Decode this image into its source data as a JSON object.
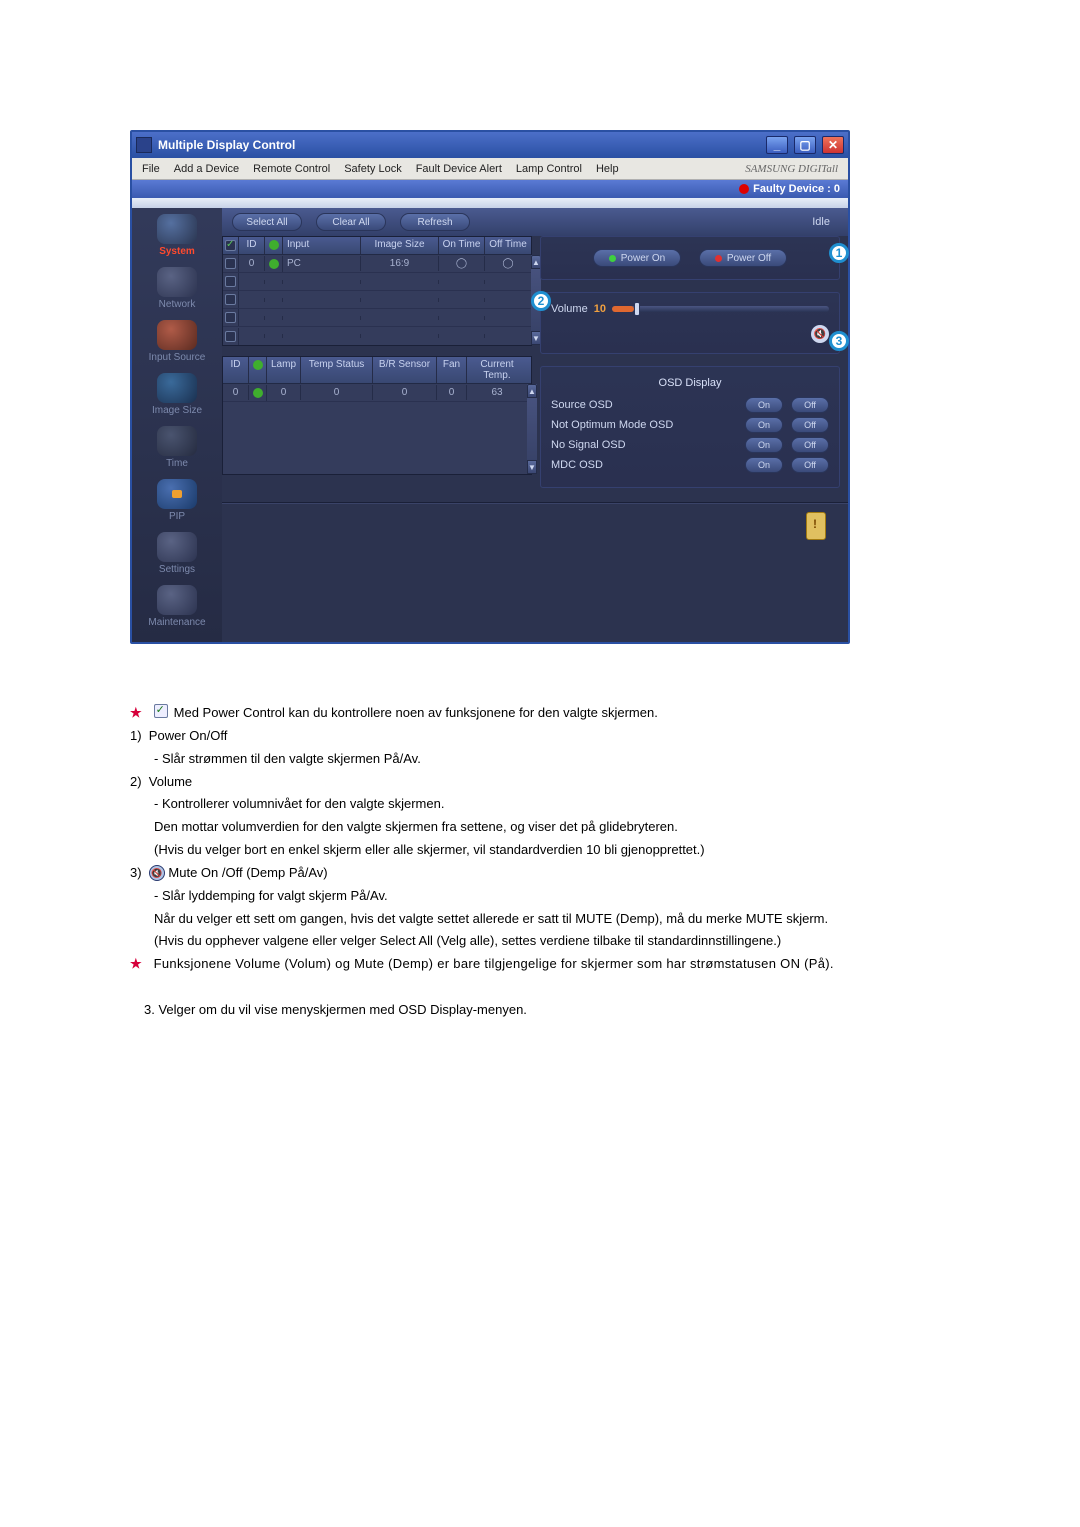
{
  "titlebar": {
    "title": "Multiple Display Control"
  },
  "menubar": {
    "items": [
      "File",
      "Add a Device",
      "Remote Control",
      "Safety Lock",
      "Fault Device Alert",
      "Lamp Control",
      "Help"
    ],
    "brand": "SAMSUNG DIGITall"
  },
  "statusbar": {
    "faulty": "Faulty Device : 0"
  },
  "sidebar": {
    "items": [
      {
        "label": "System"
      },
      {
        "label": "Network"
      },
      {
        "label": "Input Source"
      },
      {
        "label": "Image Size"
      },
      {
        "label": "Time"
      },
      {
        "label": "PIP"
      },
      {
        "label": "Settings"
      },
      {
        "label": "Maintenance"
      }
    ]
  },
  "toolbar": {
    "select_all": "Select All",
    "clear_all": "Clear All",
    "refresh": "Refresh",
    "idle": "Idle"
  },
  "table1": {
    "headers": [
      "",
      "ID",
      "",
      "Input",
      "Image Size",
      "On Time",
      "Off Time"
    ],
    "row": {
      "id": "0",
      "input": "PC",
      "image_size": "16:9"
    }
  },
  "table2": {
    "headers": [
      "ID",
      "",
      "Lamp",
      "Temp Status",
      "B/R Sensor",
      "Fan",
      "Current Temp."
    ],
    "row": {
      "id": "0",
      "lamp": "0",
      "temp_status": "0",
      "br": "0",
      "fan": "0",
      "cur": "63"
    }
  },
  "power": {
    "on": "Power On",
    "off": "Power Off",
    "callout": "1"
  },
  "volume": {
    "label": "Volume",
    "value": "10",
    "callout2": "2",
    "callout3": "3"
  },
  "osd": {
    "title": "OSD Display",
    "rows": [
      {
        "label": "Source OSD",
        "on": "On",
        "off": "Off"
      },
      {
        "label": "Not Optimum Mode OSD",
        "on": "On",
        "off": "Off"
      },
      {
        "label": "No Signal OSD",
        "on": "On",
        "off": "Off"
      },
      {
        "label": "MDC OSD",
        "on": "On",
        "off": "Off"
      }
    ]
  },
  "desc": {
    "intro": "Med Power Control kan du kontrollere noen av funksjonene for den valgte skjermen.",
    "h1": "Power On/Off",
    "h1a": "- Slår strømmen til den valgte skjermen På/Av.",
    "h2": "Volume",
    "h2a": "- Kontrollerer volumnivået for den valgte skjermen.",
    "h2b": "Den mottar volumverdien for den valgte skjermen fra settene, og viser det på glidebryteren.",
    "h2c": "(Hvis du velger bort en enkel skjerm eller alle skjermer, vil standardverdien 10 bli gjenopprettet.)",
    "h3": "Mute On /Off (Demp På/Av)",
    "h3a": "- Slår lyddemping for valgt skjerm På/Av.",
    "h3b": "Når du velger ett sett om gangen, hvis det valgte settet allerede er satt til MUTE (Demp), må du merke MUTE skjerm.",
    "h3c": "(Hvis du opphever valgene eller velger Select All (Velg alle), settes verdiene tilbake til standardinnstillingene.)",
    "note": "Funksjonene Volume (Volum) og Mute (Demp) er bare tilgjengelige for skjermer som har strømstatusen ON (På).",
    "foot": "3. Velger om du vil vise menyskjermen med OSD Display-menyen.",
    "n1": "1)",
    "n2": "2)",
    "n3": "3)"
  }
}
